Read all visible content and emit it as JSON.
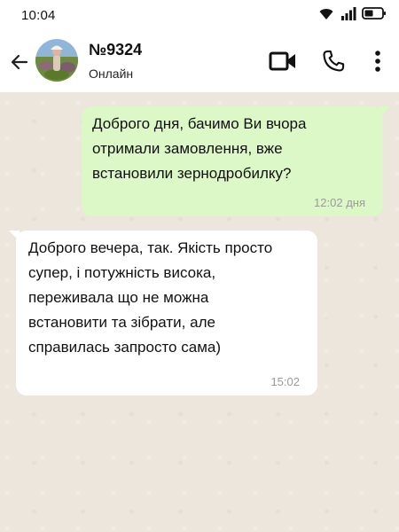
{
  "status_bar": {
    "time": "10:04",
    "icons": [
      "wifi-icon",
      "signal-icon",
      "battery-icon"
    ]
  },
  "header": {
    "contact_name": "№9324",
    "status": "Онлайн",
    "icons": [
      "back-arrow-icon",
      "video-call-icon",
      "phone-icon",
      "more-vert-icon"
    ]
  },
  "colors": {
    "outgoing_bubble": "#dcf8c6",
    "incoming_bubble": "#ffffff",
    "chat_background": "#ede6dd"
  },
  "messages": [
    {
      "direction": "outgoing",
      "text": "Доброго дня, бачимо Ви вчора\nотримали замовлення, вже\nвстановили зернодробилку?",
      "time": "12:02 дня"
    },
    {
      "direction": "incoming",
      "text": " Доброго вечера, так. Якість просто\nсупер, і потужність висока,\nпереживала що не можна\nвстановити та зібрати, але\nсправилась запросто сама)",
      "time": "15:02"
    }
  ]
}
